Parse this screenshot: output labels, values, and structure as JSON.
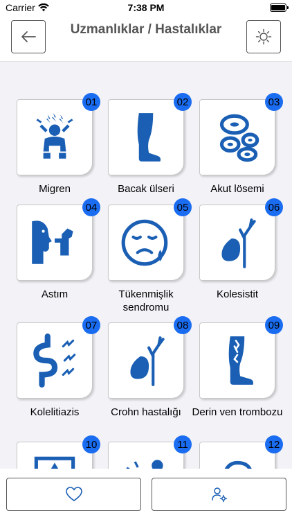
{
  "status_bar": {
    "carrier": "Carrier",
    "time": "7:38 PM"
  },
  "header": {
    "title": "Uzmanlıklar / Hastalıklar"
  },
  "colors": {
    "accent": "#1a6cf0",
    "icon": "#1a5fb4"
  },
  "items": [
    {
      "num": "01",
      "label": "Migren",
      "icon": "migraine-icon"
    },
    {
      "num": "02",
      "label": "Bacak ülseri",
      "icon": "leg-icon"
    },
    {
      "num": "03",
      "label": "Akut lösemi",
      "icon": "blood-cells-icon"
    },
    {
      "num": "04",
      "label": "Astım",
      "icon": "asthma-inhaler-icon"
    },
    {
      "num": "05",
      "label": "Tükenmişlik sendromu",
      "icon": "sad-face-icon"
    },
    {
      "num": "06",
      "label": "Kolesistit",
      "icon": "gallbladder-icon"
    },
    {
      "num": "07",
      "label": "Kolelitiazis",
      "icon": "intestine-icon"
    },
    {
      "num": "08",
      "label": "Crohn hastalığı",
      "icon": "gallbladder-icon"
    },
    {
      "num": "09",
      "label": "Derin ven trombozu",
      "icon": "leg-vein-icon"
    },
    {
      "num": "10",
      "label": "",
      "icon": "warning-icon"
    },
    {
      "num": "11",
      "label": "",
      "icon": "person-icon"
    },
    {
      "num": "12",
      "label": "",
      "icon": "loop-icon"
    }
  ]
}
